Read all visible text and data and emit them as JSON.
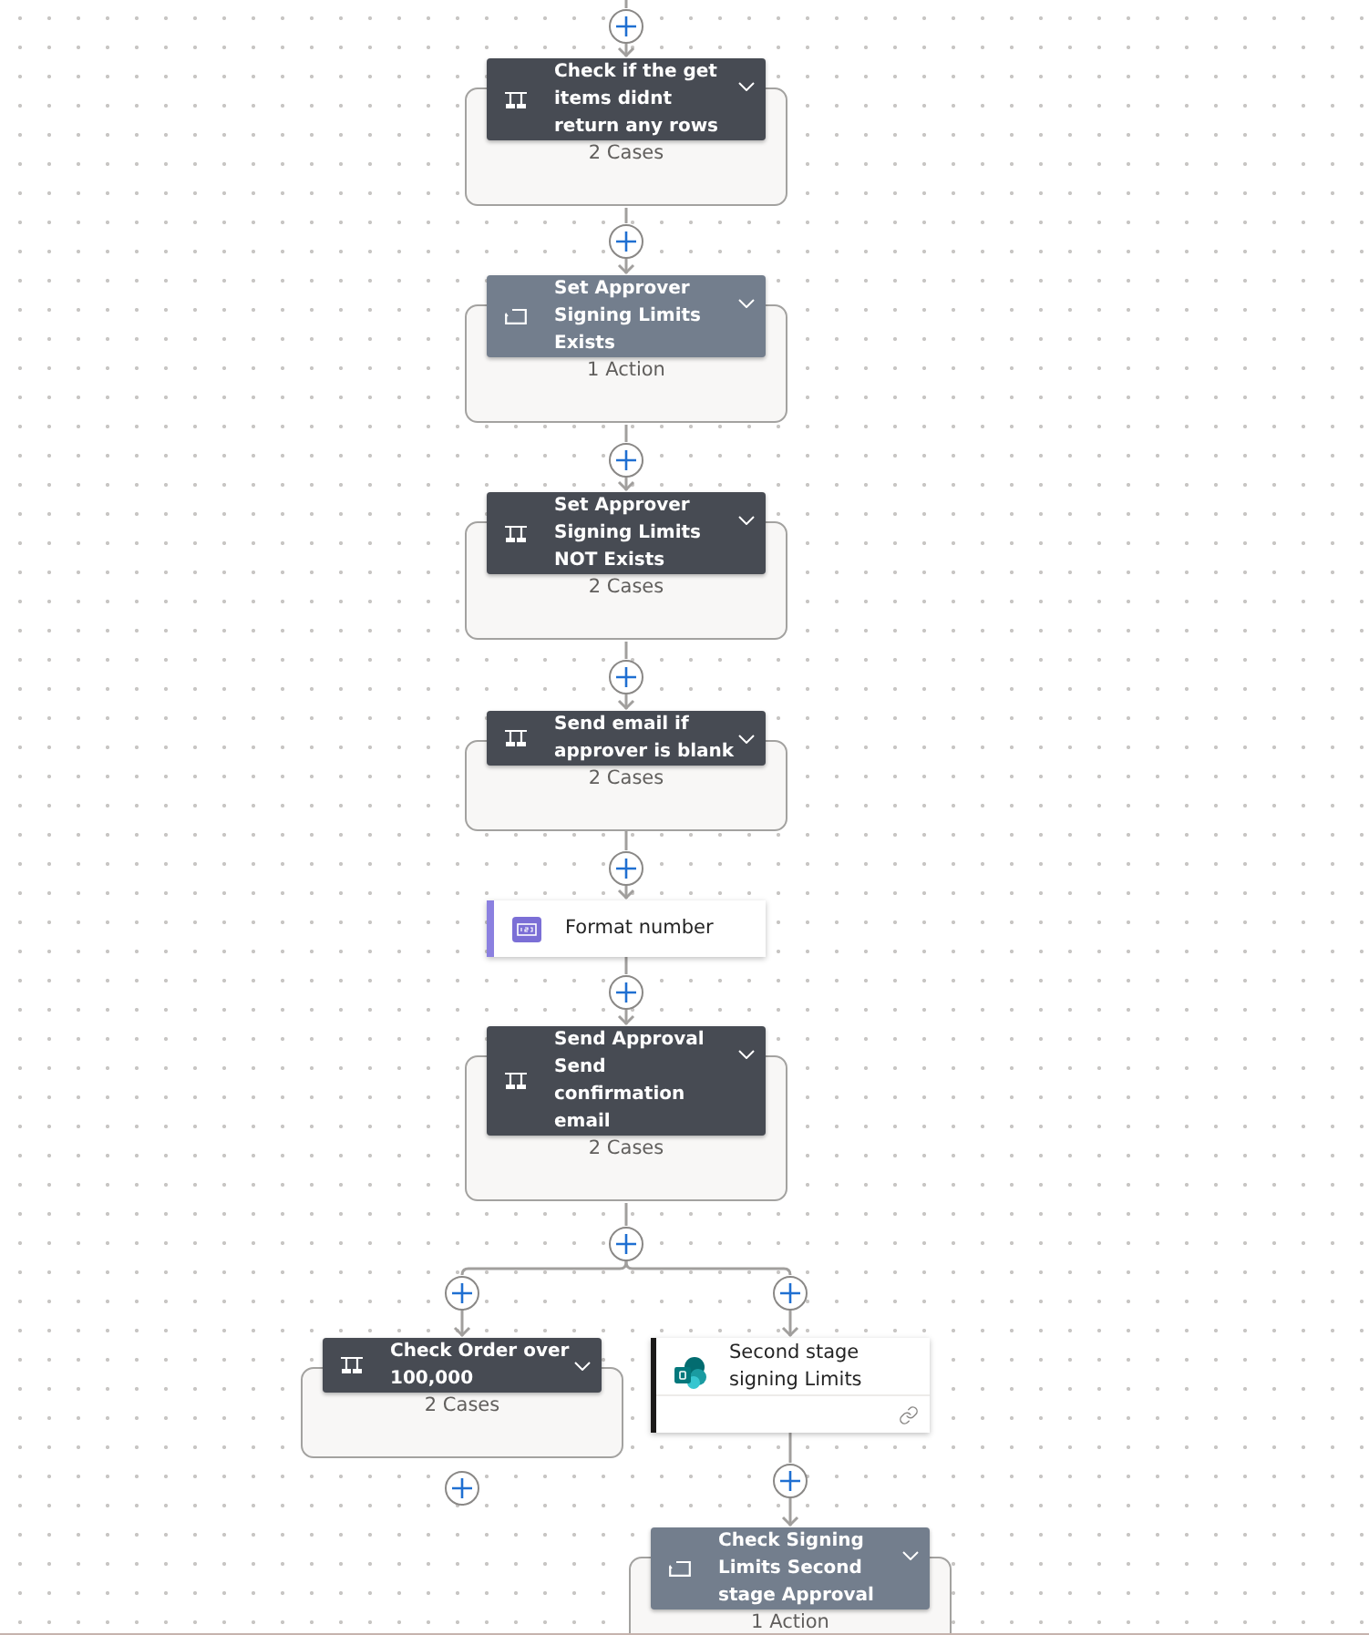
{
  "flow": {
    "steps": [
      {
        "kind": "switch",
        "title": "Check if the get items didnt return any rows",
        "summary": "2 Cases"
      },
      {
        "kind": "loop",
        "title": "Set Approver Signing Limits Exists",
        "summary": "1 Action"
      },
      {
        "kind": "switch",
        "title": "Set Approver Signing Limits NOT Exists",
        "summary": "2 Cases"
      },
      {
        "kind": "switch",
        "title": "Send email if approver is blank",
        "summary": "2 Cases"
      },
      {
        "kind": "format",
        "title": "Format number"
      },
      {
        "kind": "switch",
        "title": "Send Approval Send confirmation email",
        "summary": "2 Cases"
      }
    ],
    "branches": [
      {
        "steps": [
          {
            "kind": "switch",
            "title": "Check Order over 100,000",
            "summary": "2 Cases"
          }
        ]
      },
      {
        "steps": [
          {
            "kind": "datasource",
            "title": "Second stage signing Limits"
          },
          {
            "kind": "loop",
            "title": "Check Signing Limits Second stage Approval",
            "summary": "1 Action"
          }
        ]
      }
    ]
  }
}
